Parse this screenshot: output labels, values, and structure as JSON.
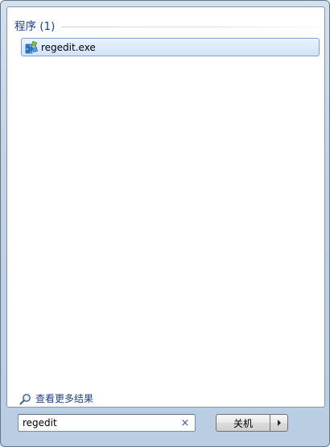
{
  "results": {
    "group_title": "程序 (1)",
    "items": [
      {
        "label": "regedit.exe",
        "icon": "registry-editor-icon"
      }
    ]
  },
  "see_more": {
    "label": "查看更多结果",
    "icon": "magnifier-icon"
  },
  "search": {
    "value": "regedit",
    "clear_glyph": "×"
  },
  "shutdown": {
    "label": "关机",
    "arrow_icon": "chevron-right-icon"
  },
  "colors": {
    "accent_text": "#1e3f86",
    "selected_border": "#7da2ce",
    "selected_fill": "#dcebfc"
  }
}
